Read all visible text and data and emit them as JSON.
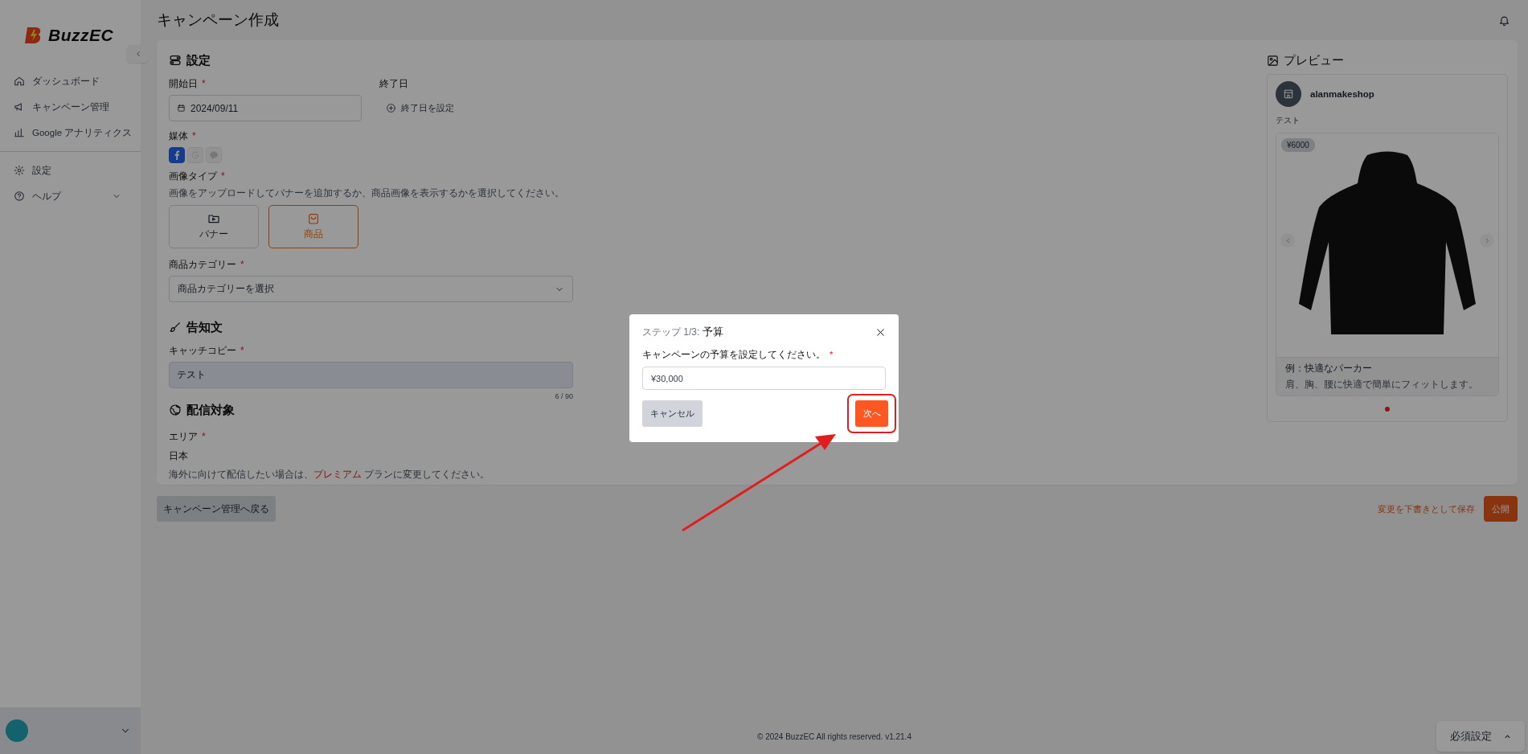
{
  "sidebar": {
    "brand": "BuzzEC",
    "nav": [
      {
        "label": "ダッシュボード"
      },
      {
        "label": "キャンペーン管理"
      },
      {
        "label": "Google アナリティクス"
      }
    ],
    "secondary": [
      {
        "label": "設定"
      },
      {
        "label": "ヘルプ",
        "expanded": false
      }
    ]
  },
  "page": {
    "title": "キャンペーン作成"
  },
  "settings": {
    "heading": "設定",
    "start_date": {
      "label": "開始日",
      "required_mark": "*",
      "value": "2024/09/11"
    },
    "end_date": {
      "label": "終了日",
      "action": "終了日を設定"
    },
    "media": {
      "label": "媒体",
      "required_mark": "*",
      "options": [
        {
          "selected": true
        },
        {
          "selected": false
        },
        {
          "selected": false
        }
      ]
    },
    "image_type": {
      "label": "画像タイプ",
      "required_mark": "*",
      "help": "画像をアップロードしてバナーを追加するか、商品画像を表示するかを選択してください。",
      "options": [
        {
          "label": "バナー",
          "selected": false
        },
        {
          "label": "商品",
          "selected": true
        }
      ]
    },
    "category": {
      "label": "商品カテゴリー",
      "required_mark": "*",
      "placeholder": "商品カテゴリーを選択"
    }
  },
  "announcement": {
    "heading": "告知文",
    "catch_copy": {
      "label": "キャッチコピー",
      "required_mark": "*",
      "value": "テスト",
      "counter": "6 / 90"
    }
  },
  "delivery": {
    "heading": "配信対象",
    "area": {
      "label": "エリア",
      "required_mark": "*",
      "value": "日本"
    },
    "note": {
      "before": "海外に向けて配信したい場合は、",
      "link": "プレミアム",
      "after": " プランに変更してください。"
    }
  },
  "preview": {
    "heading": "プレビュー",
    "shop": "alanmakeshop",
    "text": "テスト",
    "price": "¥6000",
    "product_title": "例：快適なパーカー",
    "product_description": "肩、胸、腰に快適で簡単にフィットします。",
    "dots": [
      {
        "selected": true
      }
    ]
  },
  "actions": {
    "back": "キャンペーン管理へ戻る",
    "save_draft": "変更を下書きとして保存",
    "publish": "公開"
  },
  "footer": "© 2024 BuzzEC All rights reserved. v1.21.4",
  "required_panel": {
    "label": "必須設定",
    "expanded": false
  },
  "modal": {
    "step": "ステップ 1/3:",
    "title": "予算",
    "label": "キャンペーンの予算を設定してください。",
    "required_mark": "*",
    "value": "¥30,000",
    "cancel": "キャンセル",
    "next": {
      "label": "次へ",
      "highlighted": true
    }
  }
}
